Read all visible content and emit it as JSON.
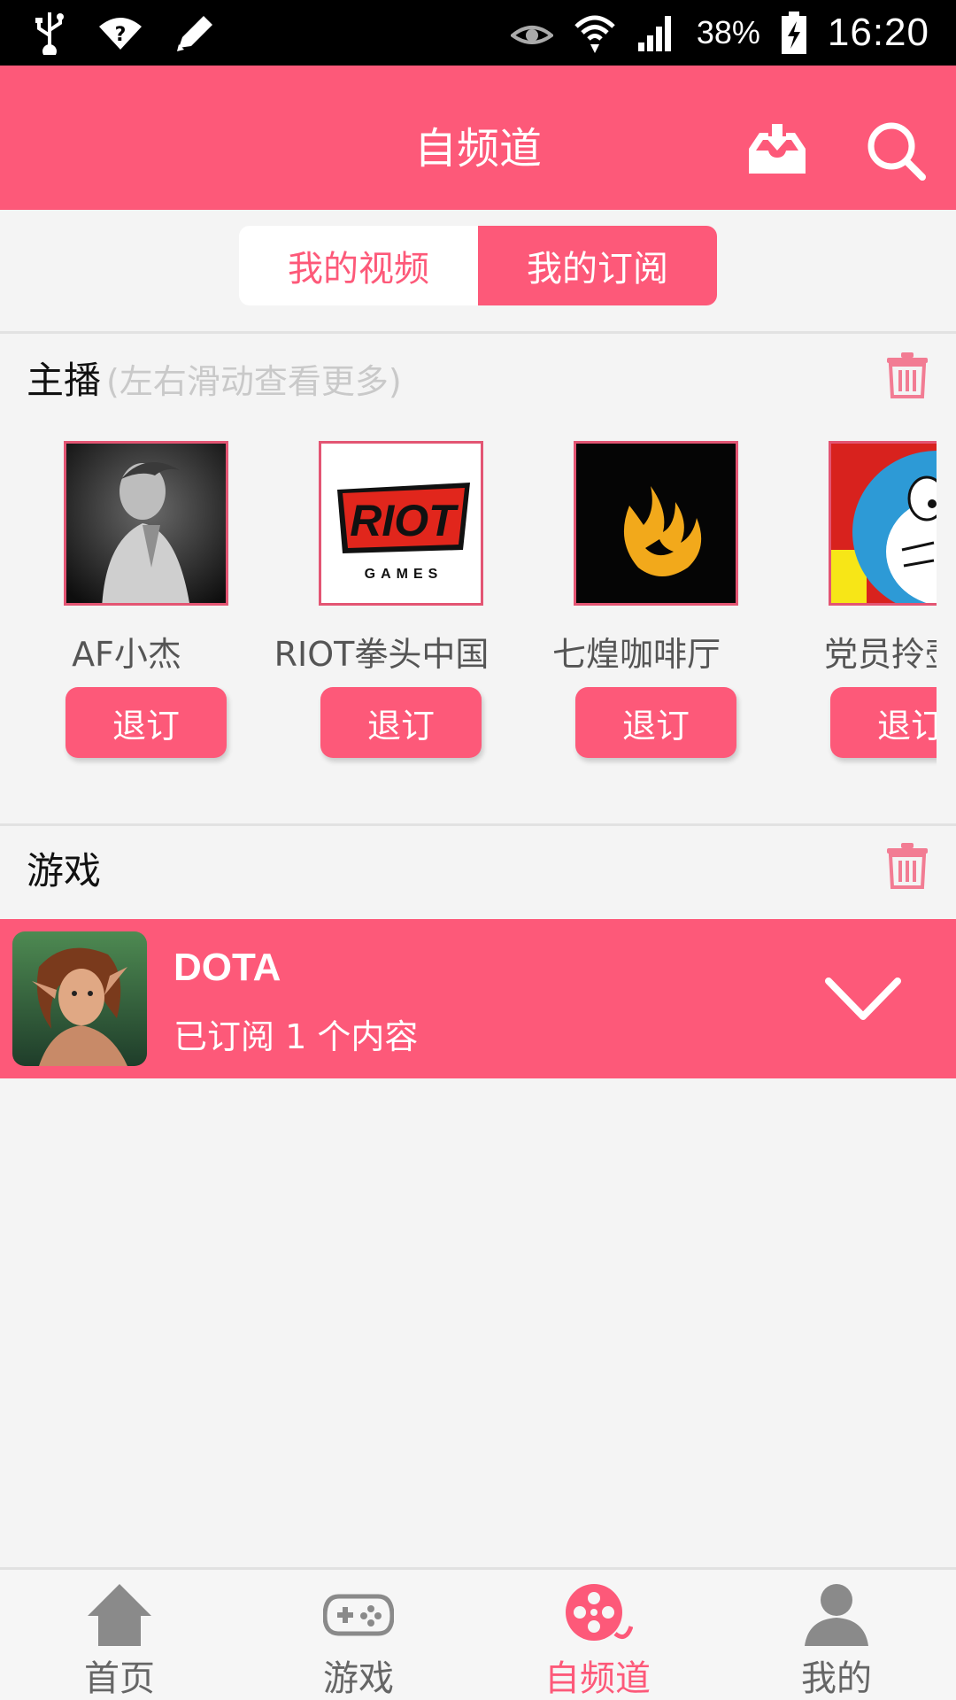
{
  "status_bar": {
    "battery_percent": "38%",
    "time": "16:20",
    "icons": [
      "usb-icon",
      "wifi-question-icon",
      "edit-icon",
      "eye-icon",
      "wifi-icon",
      "signal-icon",
      "battery-icon"
    ]
  },
  "header": {
    "title": "自频道",
    "actions": [
      "download-icon",
      "search-icon"
    ]
  },
  "tabs": [
    {
      "label": "我的视频",
      "active": false
    },
    {
      "label": "我的订阅",
      "active": true
    }
  ],
  "anchors_section": {
    "title": "主播",
    "hint": "(左右滑动查看更多)",
    "items": [
      {
        "name": "AF小杰",
        "button": "退订"
      },
      {
        "name": "RIOT拳头中国",
        "button": "退订"
      },
      {
        "name": "七煌咖啡厅",
        "button": "退订"
      },
      {
        "name": "党员拎壶",
        "button": "退订"
      }
    ],
    "logo_text": {
      "riot": "RIOT",
      "games": "GAMES"
    }
  },
  "games_section": {
    "title": "游戏",
    "items": [
      {
        "name": "DOTA",
        "subtitle": "已订阅 1 个内容"
      }
    ]
  },
  "bottom_nav": [
    {
      "label": "首页",
      "icon": "home-icon",
      "active": false
    },
    {
      "label": "游戏",
      "icon": "gamepad-icon",
      "active": false
    },
    {
      "label": "自频道",
      "icon": "film-reel-icon",
      "active": true
    },
    {
      "label": "我的",
      "icon": "person-icon",
      "active": false
    }
  ],
  "colors": {
    "accent": "#fd5979",
    "background": "#f4f4f4",
    "status_bar": "#000000",
    "trash": "#f27c93"
  }
}
